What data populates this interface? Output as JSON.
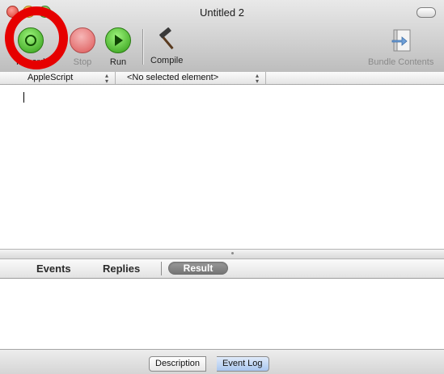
{
  "window": {
    "title": "Untitled 2"
  },
  "toolbar": {
    "record_label": "Record",
    "stop_label": "Stop",
    "run_label": "Run",
    "compile_label": "Compile",
    "bundle_label": "Bundle Contents"
  },
  "navbar": {
    "language_label": "AppleScript",
    "element_label": "<No selected element>"
  },
  "editor": {
    "content": ""
  },
  "tabs": {
    "events": "Events",
    "replies": "Replies",
    "result": "Result",
    "selected": "Result"
  },
  "bottom": {
    "description_label": "Description",
    "event_log_label": "Event Log",
    "selected": "Event Log"
  },
  "colors": {
    "annotation": "#e60000",
    "selected_segment": "#a9c6ef",
    "selected_tab": "#7f7f7f"
  },
  "icons": {
    "record": "record-icon",
    "stop": "stop-icon",
    "run": "run-icon",
    "compile": "hammer-icon",
    "bundle": "bundle-contents-icon"
  }
}
